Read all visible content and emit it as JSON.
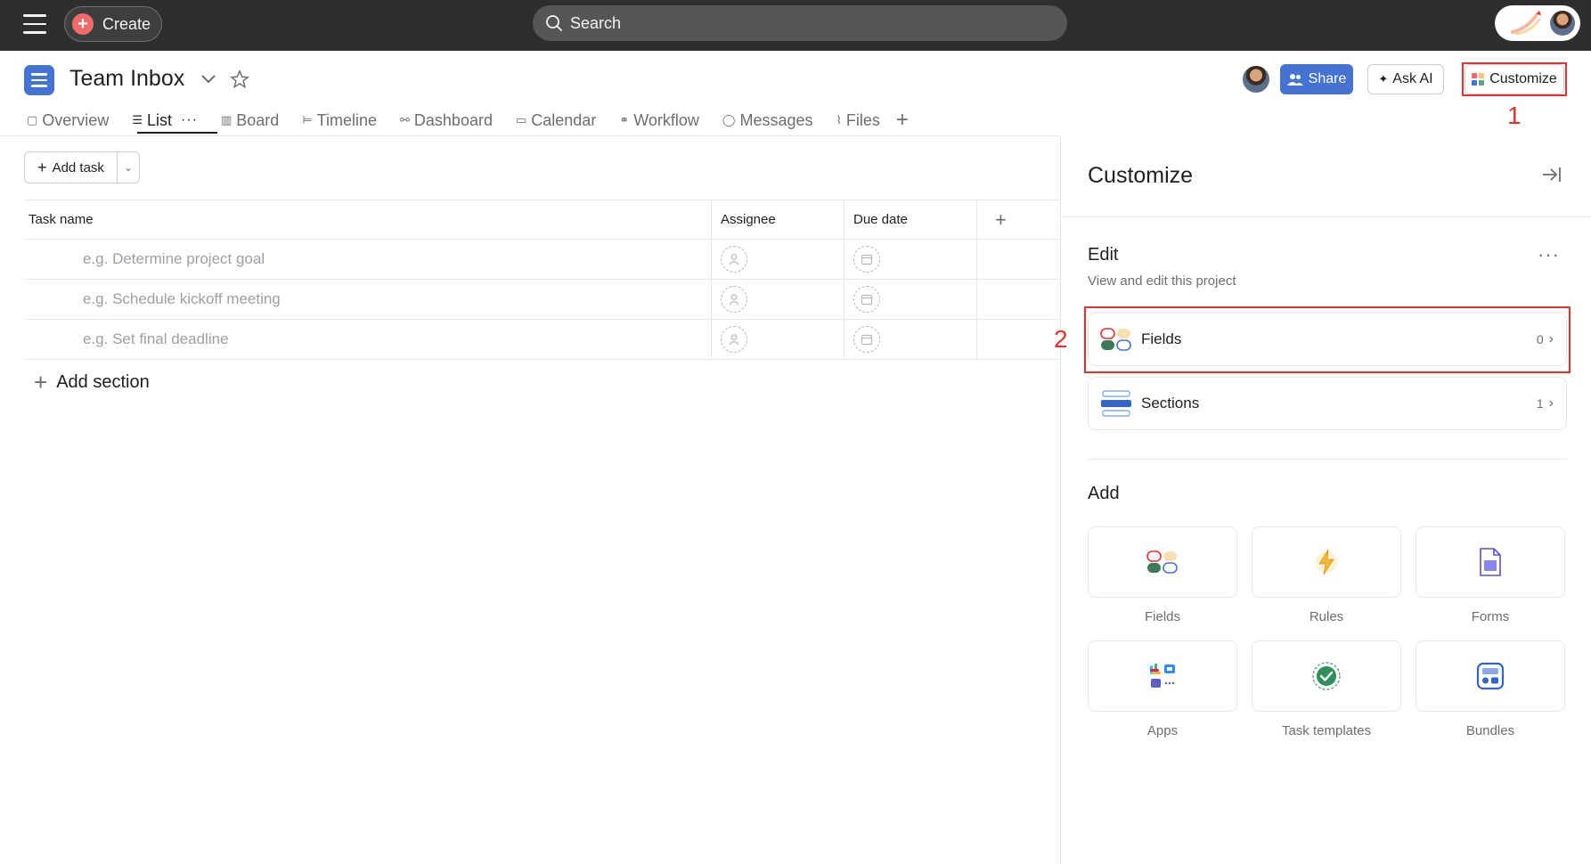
{
  "topbar": {
    "create_label": "Create",
    "search_placeholder": "Search"
  },
  "header": {
    "project_title": "Team Inbox",
    "share_label": "Share",
    "ask_ai_label": "Ask AI",
    "customize_label": "Customize",
    "callout_1": "1",
    "callout_2": "2"
  },
  "tabs": [
    {
      "label": "Overview",
      "icon": "overview-icon"
    },
    {
      "label": "List",
      "icon": "list-icon"
    },
    {
      "label": "Board",
      "icon": "board-icon"
    },
    {
      "label": "Timeline",
      "icon": "timeline-icon"
    },
    {
      "label": "Dashboard",
      "icon": "dashboard-icon"
    },
    {
      "label": "Calendar",
      "icon": "calendar-icon"
    },
    {
      "label": "Workflow",
      "icon": "workflow-icon"
    },
    {
      "label": "Messages",
      "icon": "messages-icon"
    },
    {
      "label": "Files",
      "icon": "files-icon"
    }
  ],
  "list": {
    "add_task_label": "Add task",
    "columns": [
      "Task name",
      "Assignee",
      "Due date"
    ],
    "rows": [
      {
        "placeholder": "e.g. Determine project goal"
      },
      {
        "placeholder": "e.g. Schedule kickoff meeting"
      },
      {
        "placeholder": "e.g. Set final deadline"
      }
    ],
    "add_section_label": "Add section"
  },
  "panel": {
    "title": "Customize",
    "edit_title": "Edit",
    "edit_subtitle": "View and edit this project",
    "fields_label": "Fields",
    "fields_count": "0",
    "sections_label": "Sections",
    "sections_count": "1",
    "add_title": "Add",
    "tiles": [
      {
        "label": "Fields",
        "icon": "fields-icon"
      },
      {
        "label": "Rules",
        "icon": "lightning-icon"
      },
      {
        "label": "Forms",
        "icon": "form-icon"
      },
      {
        "label": "Apps",
        "icon": "apps-icon"
      },
      {
        "label": "Task templates",
        "icon": "check-circle-icon"
      },
      {
        "label": "Bundles",
        "icon": "bundle-icon"
      }
    ]
  },
  "colors": {
    "accent": "#4573d2",
    "highlight": "#e8312e",
    "topbar": "#2e2e30",
    "create": "#f06a6a"
  }
}
